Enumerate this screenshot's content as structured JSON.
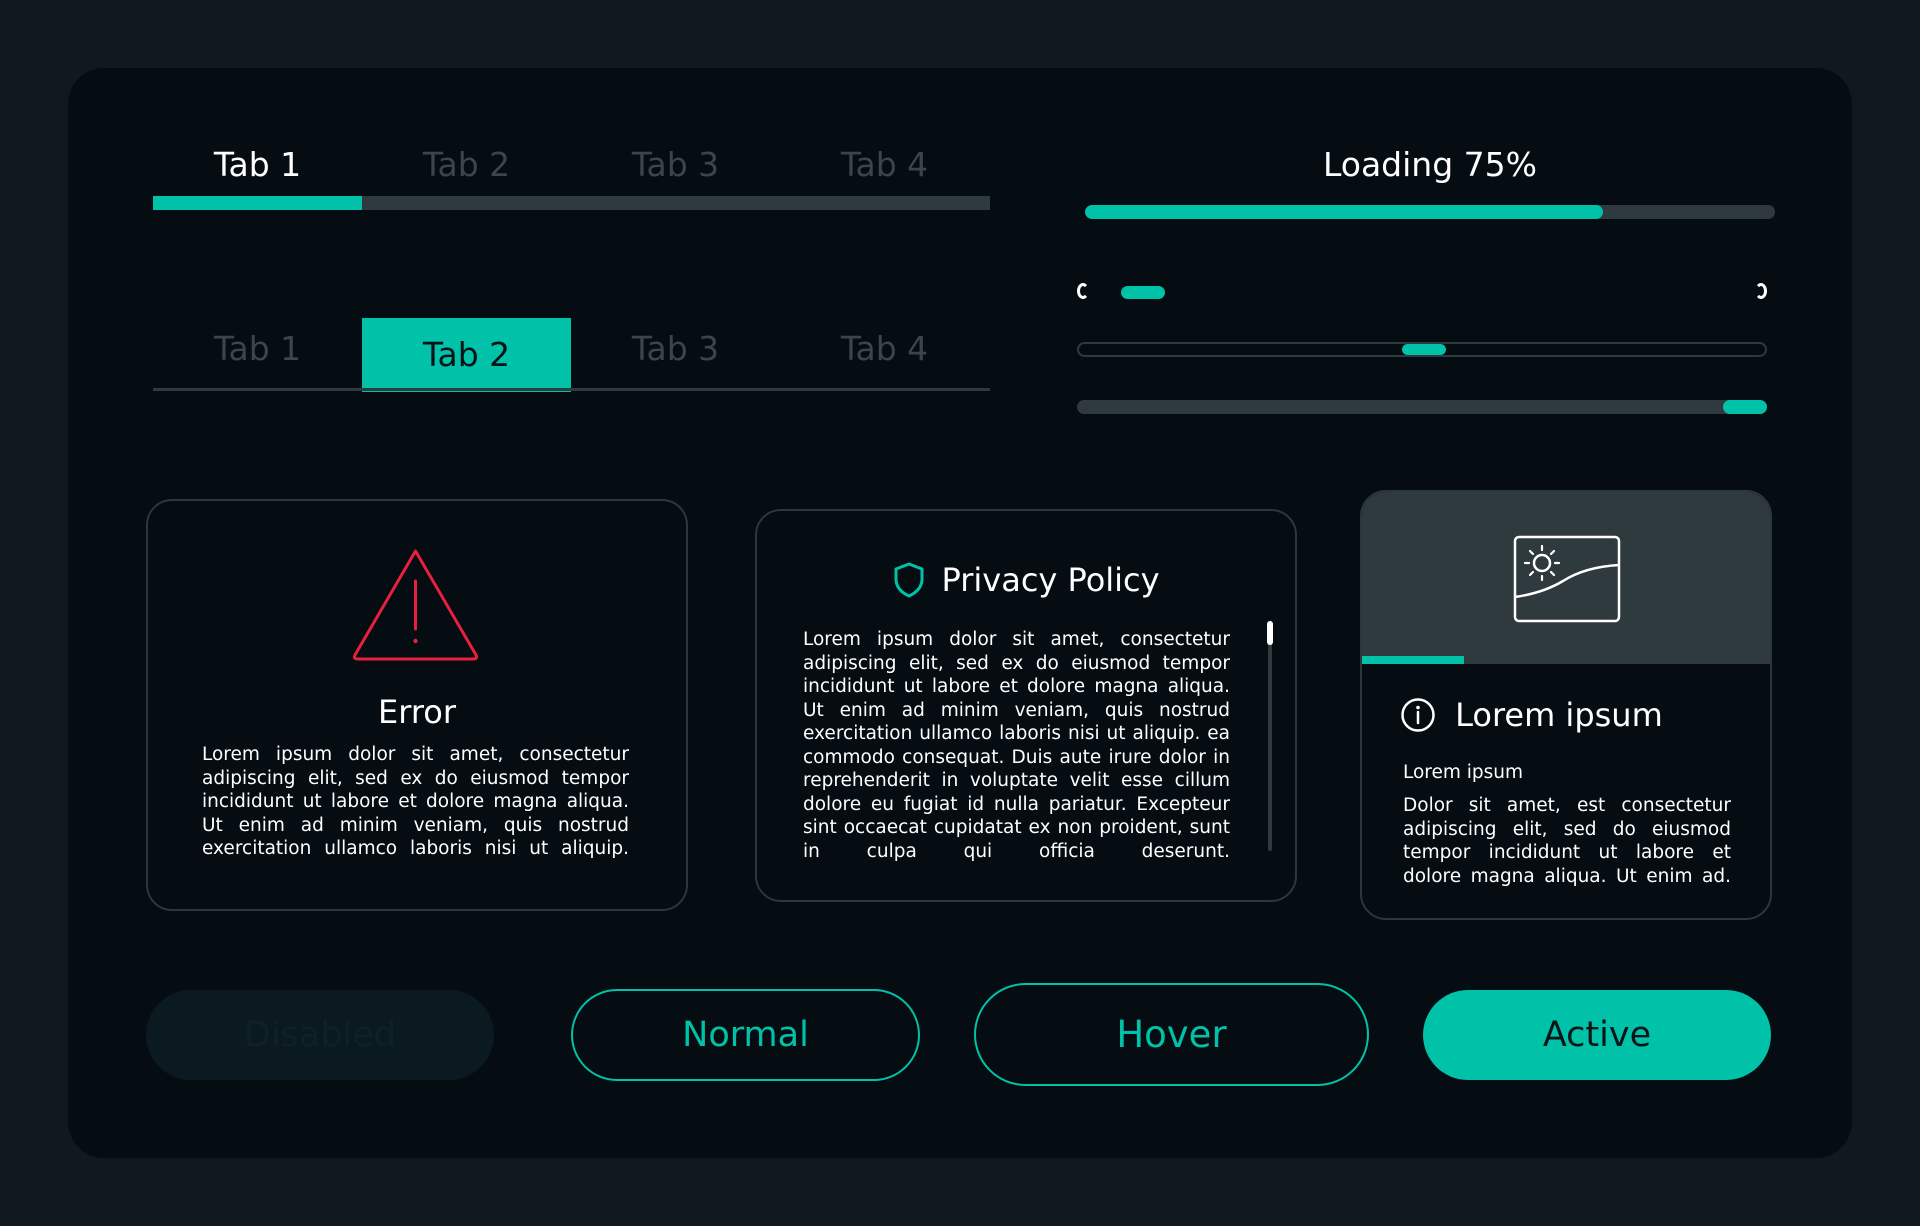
{
  "colors": {
    "accent": "#00c2a8",
    "error": "#e8203f",
    "panel": "#050c12",
    "background": "#111920",
    "muted": "#2f3a3f"
  },
  "tabs_primary": {
    "items": [
      "Tab 1",
      "Tab 2",
      "Tab 3",
      "Tab 4"
    ],
    "active_index": 0
  },
  "tabs_secondary": {
    "items": [
      "Tab 1",
      "Tab 2",
      "Tab 3",
      "Tab 4"
    ],
    "active_index": 1
  },
  "loading": {
    "label": "Loading 75%",
    "progress": 0.75
  },
  "sliders": [
    {
      "value": 0.04,
      "style": "capped"
    },
    {
      "value": 0.5,
      "style": "outlined"
    },
    {
      "value": 1.0,
      "style": "filled"
    }
  ],
  "error_card": {
    "icon": "warning-triangle-icon",
    "title": "Error",
    "body": "Lorem ipsum dolor sit amet, consectetur adipiscing elit, sed ex do eiusmod tempor incididunt ut labore et dolore magna aliqua. Ut enim ad minim veniam, quis nostrud exercitation ullamco laboris nisi ut aliquip."
  },
  "privacy_card": {
    "icon": "shield-icon",
    "title": "Privacy Policy",
    "body": "Lorem ipsum dolor sit amet, consectetur adipiscing elit, sed ex do eiusmod tempor incididunt ut labore et dolore magna aliqua. Ut enim ad minim veniam, quis nostrud exercitation ullamco laboris nisi ut aliquip. ea commodo consequat. Duis aute irure dolor in reprehenderit in voluptate velit esse cillum dolore eu fugiat id nulla pariatur. Excepteur sint occaecat cupidatat ex non proident, sunt in culpa qui officia deserunt."
  },
  "info_card": {
    "image_icon": "image-landscape-icon",
    "info_icon": "info-icon",
    "title": "Lorem ipsum",
    "subtitle": "Lorem ipsum",
    "body": "Dolor sit amet, est consectetur adipiscing elit, sed do eiusmod tempor incididunt ut labore et dolore magna aliqua. Ut enim ad.",
    "progress": 0.25
  },
  "buttons": {
    "disabled": "Disabled",
    "normal": "Normal",
    "hover": "Hover",
    "active": "Active"
  }
}
